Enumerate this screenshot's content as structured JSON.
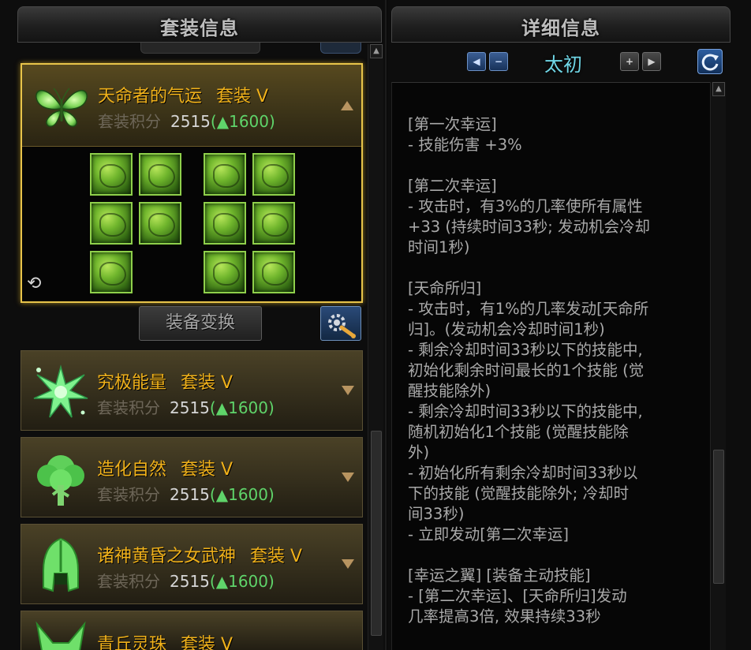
{
  "left_panel": {
    "title": "套装信息",
    "expanded_set": {
      "name": "天命者的气运",
      "tier": "套装 V",
      "score_label": "套装积分",
      "score_value": "2515",
      "score_delta": "(▲1600)",
      "icon": "butterfly-icon"
    },
    "transform_button": "装备变换",
    "settings_icon": "wrench-gear-icon",
    "sets": [
      {
        "name": "究极能量",
        "tier": "套装 V",
        "score_label": "套装积分",
        "score_value": "2515",
        "score_delta": "(▲1600)",
        "icon": "energy-burst-icon"
      },
      {
        "name": "造化自然",
        "tier": "套装 V",
        "score_label": "套装积分",
        "score_value": "2515",
        "score_delta": "(▲1600)",
        "icon": "tree-icon"
      },
      {
        "name": "诸神黄昏之女武神",
        "tier": "套装 V",
        "score_label": "套装积分",
        "score_value": "2515",
        "score_delta": "(▲1600)",
        "icon": "valkyrie-helmet-icon"
      },
      {
        "name": "青丘灵珠",
        "tier": "套装 V",
        "icon": "fox-icon"
      }
    ]
  },
  "right_panel": {
    "title": "详细信息",
    "nav_title": "太初",
    "nav_prev": "◀",
    "nav_minus": "−",
    "nav_plus": "+",
    "nav_next": "▶",
    "detail_text": "[第一次幸运]\n- 技能伤害 +3%\n\n[第二次幸运]\n- 攻击时，有3%的几率使所有属性\n+33 (持续时间33秒; 发动机会冷却\n时间1秒)\n\n[天命所归]\n- 攻击时，有1%的几率发动[天命所\n归]。(发动机会冷却时间1秒)\n- 剩余冷却时间33秒以下的技能中,\n初始化剩余时间最长的1个技能 (觉\n醒技能除外)\n- 剩余冷却时间33秒以下的技能中,\n随机初始化1个技能 (觉醒技能除\n外)\n- 初始化所有剩余冷却时间33秒以\n下的技能 (觉醒技能除外; 冷却时\n间33秒)\n- 立即发动[第二次幸运]\n\n[幸运之翼] [装备主动技能]\n- [第二次幸运]、[天命所归]发动\n几率提高3倍, 效果持续33秒"
  },
  "colors": {
    "set_name": "#f0b11a",
    "score_delta": "#5fd46a",
    "nav_title": "#6fd6e6",
    "highlight_border": "#e8c44a"
  }
}
